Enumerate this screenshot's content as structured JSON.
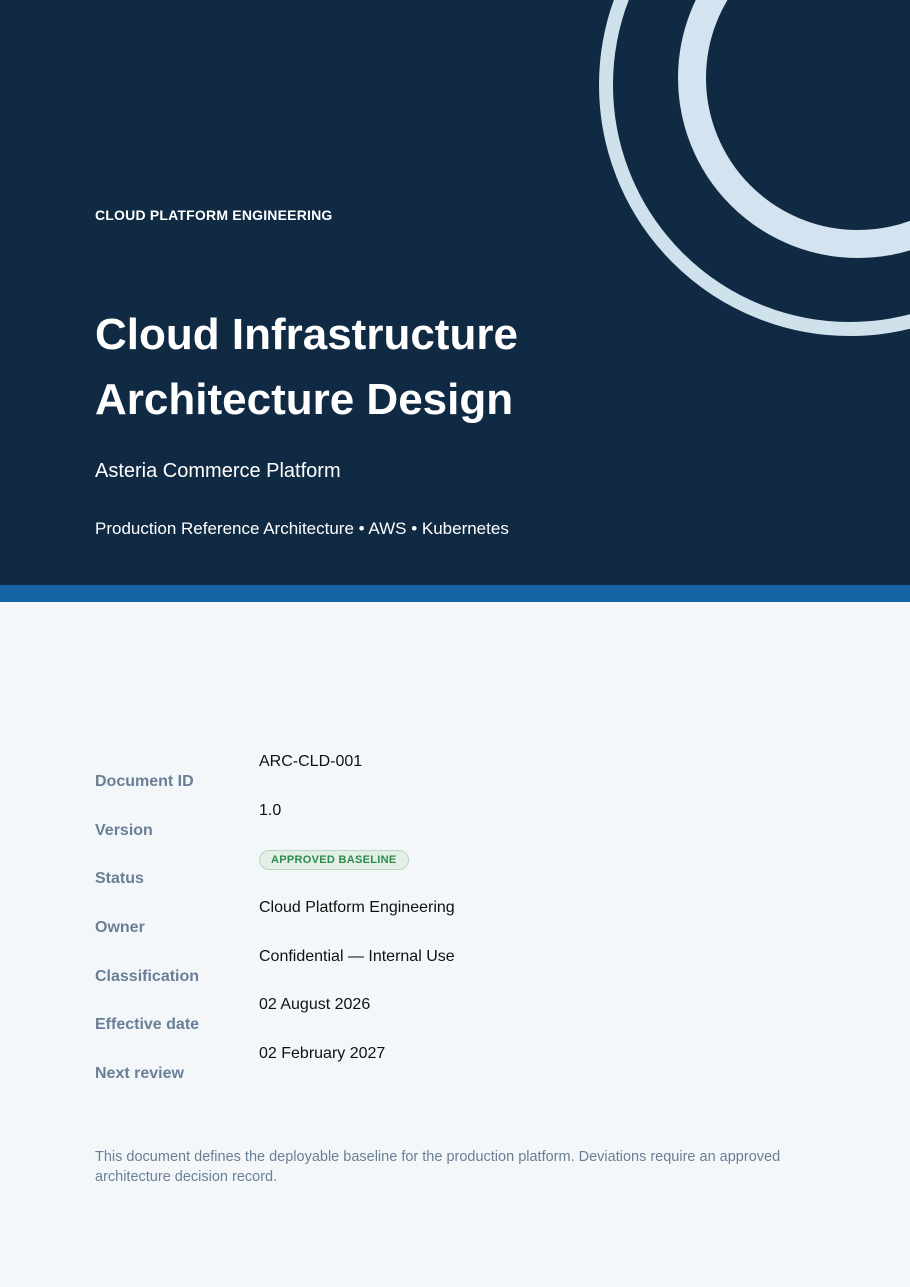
{
  "header": {
    "eyebrow": "CLOUD PLATFORM ENGINEERING",
    "title_line1": "Cloud Infrastructure",
    "title_line2": "Architecture Design",
    "subtitle": "Asteria Commerce Platform",
    "tagline": "Production Reference Architecture • AWS • Kubernetes"
  },
  "metadata": {
    "labels": [
      "Document ID",
      "Version",
      "Status",
      "Owner",
      "Classification",
      "Effective date",
      "Next review"
    ],
    "document_id": "ARC-CLD-001",
    "version": "1.0",
    "status": "APPROVED BASELINE",
    "owner": "Cloud Platform Engineering",
    "classification": "Confidential — Internal Use",
    "effective_date": "02 August 2026",
    "next_review": "02 February 2027"
  },
  "footnote": "This document defines the deployable baseline for the production platform. Deviations require an approved architecture decision record.",
  "colors": {
    "hero_background": "#102a44",
    "accent_bar": "#1565a6",
    "page_background": "#f3f7fa",
    "label_text": "#6a7f95",
    "status_green": "#2d8a4c"
  }
}
